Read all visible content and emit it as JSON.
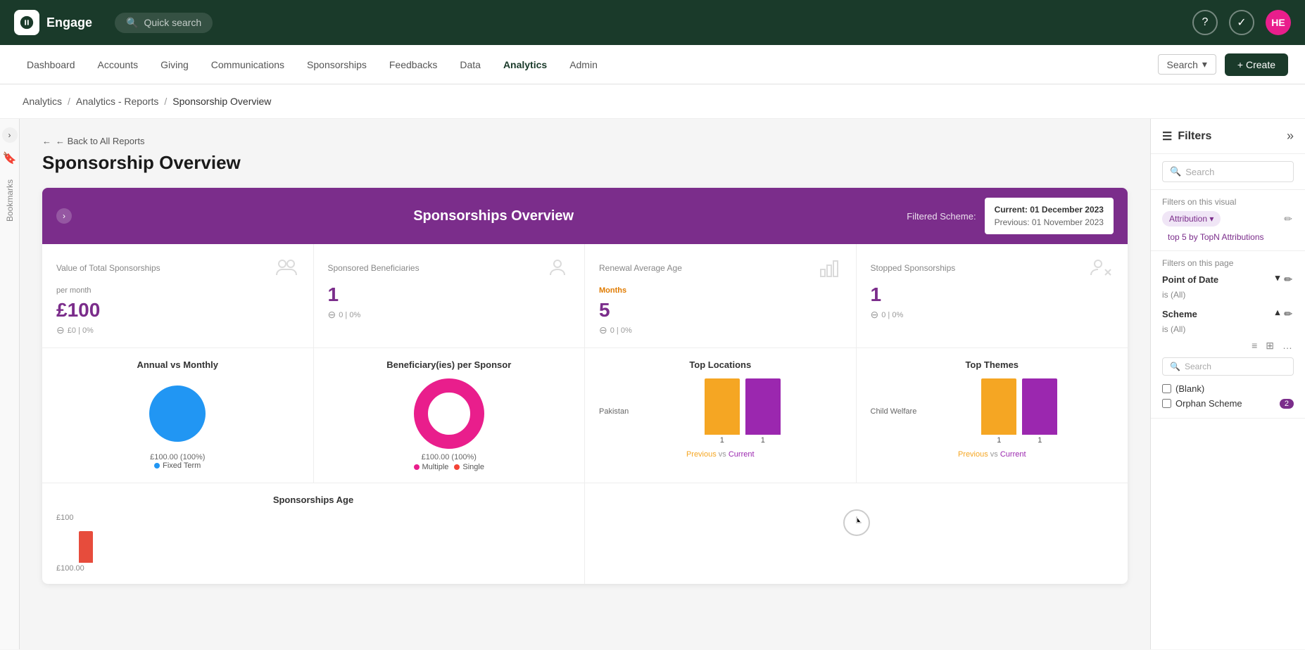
{
  "app": {
    "name": "Engage",
    "quick_search": "Quick search"
  },
  "top_nav_right": {
    "avatar_initials": "HE",
    "help_icon": "?",
    "check_icon": "✓"
  },
  "sec_nav": {
    "items": [
      {
        "label": "Dashboard",
        "active": false
      },
      {
        "label": "Accounts",
        "active": false
      },
      {
        "label": "Giving",
        "active": false
      },
      {
        "label": "Communications",
        "active": false
      },
      {
        "label": "Sponsorships",
        "active": false
      },
      {
        "label": "Feedbacks",
        "active": false
      },
      {
        "label": "Data",
        "active": false
      },
      {
        "label": "Analytics",
        "active": true
      },
      {
        "label": "Admin",
        "active": false
      }
    ],
    "search_label": "Search",
    "create_label": "+ Create"
  },
  "breadcrumb": {
    "items": [
      {
        "label": "Analytics",
        "link": true
      },
      {
        "label": "Analytics - Reports",
        "link": true
      },
      {
        "label": "Sponsorship Overview",
        "link": false
      }
    ]
  },
  "page": {
    "back_label": "← Back to All Reports",
    "title": "Sponsorship Overview"
  },
  "report": {
    "header_title": "Sponsorships Overview",
    "filtered_scheme_label": "Filtered Scheme:",
    "current_date": "Current: 01 December 2023",
    "previous_date": "Previous: 01 November 2023",
    "metrics": [
      {
        "label": "Value of Total Sponsorships",
        "sub_label": "per month",
        "value": "£100",
        "sub": "£0 | 0%",
        "icon": "people-money-icon"
      },
      {
        "label": "Sponsored Beneficiaries",
        "value": "1",
        "sub": "0 | 0%",
        "icon": "people-icon"
      },
      {
        "label": "Renewal Average Age",
        "months_label": "Months",
        "value": "5",
        "sub": "0 | 0%",
        "icon": "chart-icon"
      },
      {
        "label": "Stopped Sponsorships",
        "value": "1",
        "sub": "0 | 0%",
        "icon": "people-stop-icon"
      }
    ],
    "charts": [
      {
        "title": "Annual vs Monthly",
        "type": "pie_solid",
        "value_label": "£100.00 (100%)",
        "legend": [
          {
            "color": "#2196f3",
            "label": "Fixed Term"
          }
        ]
      },
      {
        "title": "Beneficiary(ies) per Sponsor",
        "type": "donut",
        "value_label": "£100.00 (100%)",
        "legend": [
          {
            "color": "#e91e8c",
            "label": "Multiple"
          },
          {
            "color": "#f44336",
            "label": "Single"
          }
        ]
      },
      {
        "title": "Top Locations",
        "type": "bar_compare",
        "location": "Pakistan",
        "prev_value": 1,
        "curr_value": 1,
        "prev_color": "#f5a623",
        "curr_color": "#9b27af",
        "vs_label": "Previous vs Current"
      },
      {
        "title": "Top Themes",
        "type": "bar_compare",
        "location": "Child Welfare",
        "prev_value": 1,
        "curr_value": 1,
        "prev_color": "#f5a623",
        "curr_color": "#9b27af",
        "vs_label": "Previous vs Current"
      }
    ],
    "bottom_charts": [
      {
        "title": "Sponsorships Age",
        "y_label": "£100",
        "x_max": "£100.00"
      }
    ]
  },
  "filters_panel": {
    "title": "Filters",
    "search_placeholder": "Search",
    "visual_filter_label": "Filters on this visual",
    "attribution_label": "Attribution",
    "attribution_value": "top 5 by TopN Attributions",
    "page_filter_label": "Filters on this page",
    "point_of_date_label": "Point of Date",
    "point_of_date_value": "is (All)",
    "scheme_label": "Scheme",
    "scheme_value": "is (All)",
    "scheme_search_placeholder": "Search",
    "blank_label": "(Blank)",
    "orphan_scheme_label": "Orphan Scheme",
    "orphan_scheme_count": "2"
  }
}
